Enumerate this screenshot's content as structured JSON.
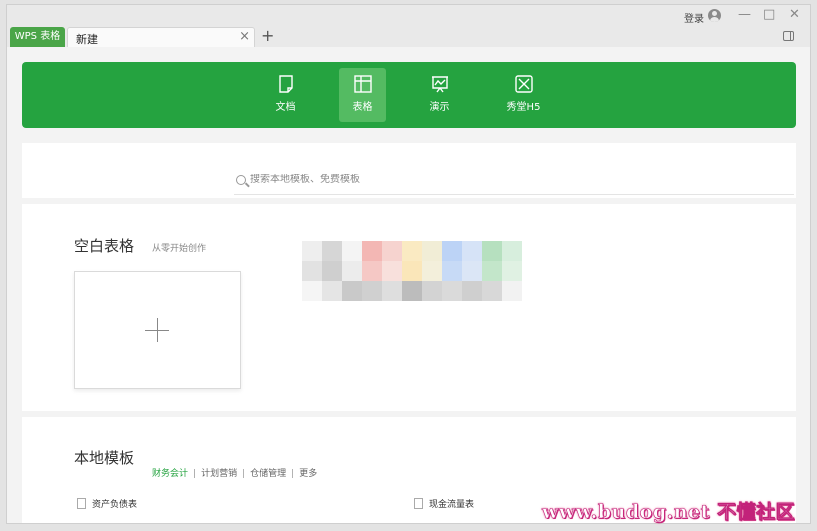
{
  "titlebar": {
    "app_tab": "WPS 表格",
    "doc_tab": "新建",
    "close_tab": "×",
    "new_tab": "+",
    "login": "登录",
    "minimize": "—",
    "maximize": "□",
    "close": "✕"
  },
  "nav": {
    "tabs": [
      {
        "label": "文档",
        "icon": "document-icon"
      },
      {
        "label": "表格",
        "icon": "table-icon",
        "active": true
      },
      {
        "label": "演示",
        "icon": "presentation-icon"
      },
      {
        "label": "秀堂H5",
        "icon": "h5-icon"
      }
    ],
    "accent": "#25a340"
  },
  "search": {
    "placeholder": "搜索本地模板、免费模板"
  },
  "blank": {
    "title": "空白表格",
    "subtitle": "从零开始创作"
  },
  "local": {
    "title": "本地模板",
    "categories": [
      "财务会计",
      "计划营销",
      "仓储管理",
      "更多"
    ],
    "templates": [
      "资产负债表",
      "现金流量表"
    ]
  },
  "watermark": "www.budog.net 不懂社区"
}
